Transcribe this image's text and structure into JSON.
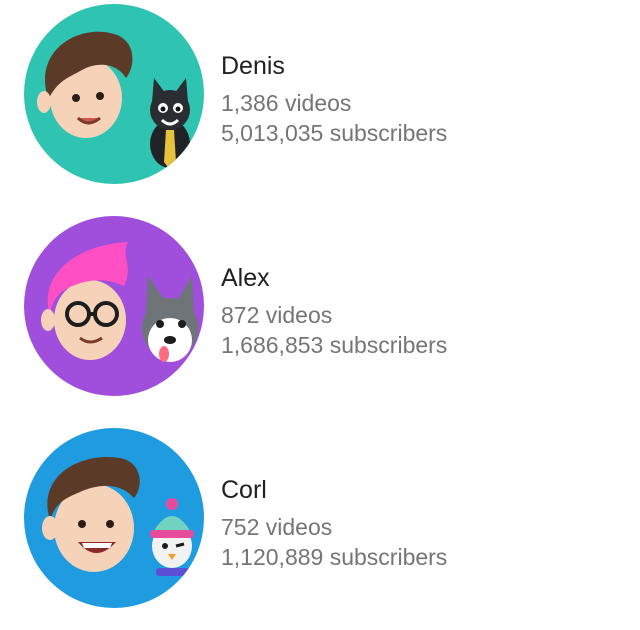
{
  "channels": [
    {
      "name": "Denis",
      "videos": "1,386 videos",
      "subscribers": "5,013,035 subscribers",
      "avatar_bg": "#2ec4b1",
      "avatar_icons": [
        "boy-face-icon",
        "black-cat-icon"
      ]
    },
    {
      "name": "Alex",
      "videos": "872 videos",
      "subscribers": "1,686,853 subscribers",
      "avatar_bg": "#a04fdc",
      "avatar_icons": [
        "pink-hair-glasses-face-icon",
        "husky-dog-icon"
      ]
    },
    {
      "name": "Corl",
      "videos": "752 videos",
      "subscribers": "1,120,889 subscribers",
      "avatar_bg": "#1f9be0",
      "avatar_icons": [
        "smiling-boy-face-icon",
        "penguin-beanie-icon"
      ]
    }
  ]
}
